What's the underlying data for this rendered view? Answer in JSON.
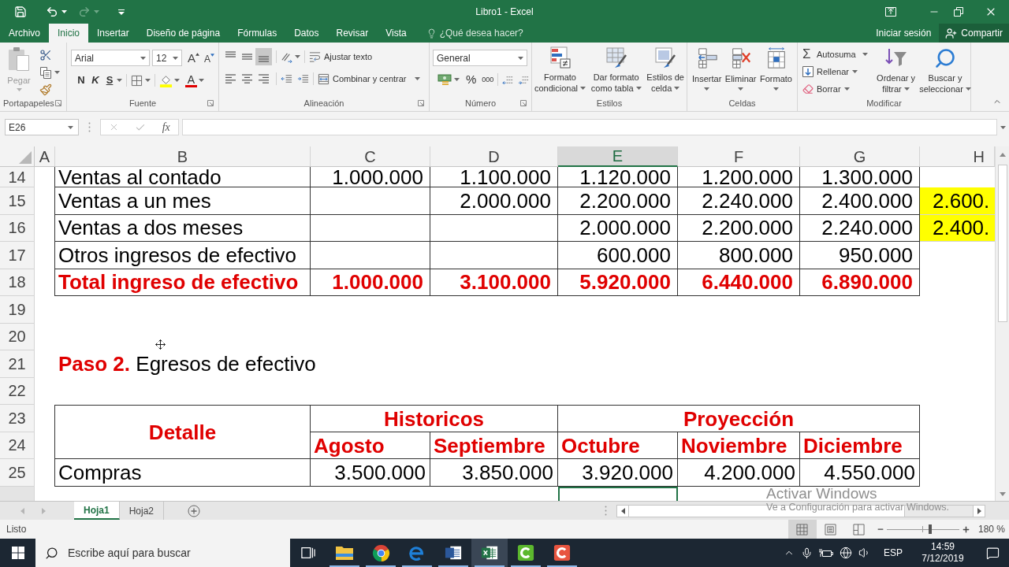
{
  "title_bar": {
    "title": "Libro1 - Excel",
    "redo": {
      "disabled": true
    }
  },
  "menu_tabs": [
    {
      "label": "Archivo",
      "selected": false
    },
    {
      "label": "Inicio",
      "selected": true
    },
    {
      "label": "Insertar",
      "selected": false
    },
    {
      "label": "Diseño de página",
      "selected": false
    },
    {
      "label": "Fórmulas",
      "selected": false
    },
    {
      "label": "Datos",
      "selected": false
    },
    {
      "label": "Revisar",
      "selected": false
    },
    {
      "label": "Vista",
      "selected": false
    }
  ],
  "tell_me": {
    "placeholder": "¿Qué desea hacer?"
  },
  "account": {
    "sign_in": "Iniciar sesión",
    "share": "Compartir"
  },
  "ribbon": {
    "clipboard": {
      "label": "Portapapeles",
      "paste": {
        "label": "Pegar",
        "disabled": true
      }
    },
    "font": {
      "label": "Fuente",
      "font_name": "Arial",
      "font_size": "12",
      "grow": "A",
      "shrink": "A",
      "bold": "N",
      "italic": "K",
      "underline": "S",
      "font_color": "A"
    },
    "alignment": {
      "label": "Alineación",
      "vertical": [
        {
          "kind": "top",
          "selected": false
        },
        {
          "kind": "middle",
          "selected": false
        },
        {
          "kind": "bottom",
          "selected": true
        }
      ],
      "horizontal": [
        {
          "kind": "left",
          "selected": false
        },
        {
          "kind": "center",
          "selected": false
        },
        {
          "kind": "right",
          "selected": false
        }
      ],
      "wrap_text": "Ajustar texto",
      "merge_center": "Combinar y centrar"
    },
    "number": {
      "label": "Número",
      "format": "General",
      "percent": "%",
      "thousands": "000"
    },
    "styles": {
      "label": "Estilos",
      "buttons": [
        {
          "kind": "conditional",
          "lines": [
            "Formato",
            "condicional"
          ]
        },
        {
          "kind": "table",
          "lines": [
            "Dar formato",
            "como tabla"
          ]
        },
        {
          "kind": "cell",
          "lines": [
            "Estilos de",
            "celda"
          ]
        }
      ]
    },
    "cells": {
      "label": "Celdas",
      "buttons": [
        {
          "kind": "insert",
          "label": "Insertar"
        },
        {
          "kind": "delete",
          "label": "Eliminar"
        },
        {
          "kind": "format",
          "label": "Formato"
        }
      ]
    },
    "editing": {
      "label": "Modificar",
      "autosum_symbol": "Σ",
      "autosum": "Autosuma",
      "fill": "Rellenar",
      "clear": "Borrar",
      "sort": [
        "Ordenar y",
        "filtrar"
      ],
      "find": [
        "Buscar y",
        "seleccionar"
      ]
    }
  },
  "formula_bar": {
    "name_box": "E26",
    "function_label": "fx"
  },
  "columns": [
    {
      "label": "A",
      "selected": false
    },
    {
      "label": "B",
      "selected": false
    },
    {
      "label": "C",
      "selected": false
    },
    {
      "label": "D",
      "selected": false
    },
    {
      "label": "E",
      "selected": true
    },
    {
      "label": "F",
      "selected": false
    },
    {
      "label": "G",
      "selected": false
    },
    {
      "label": "H",
      "selected": false
    }
  ],
  "inflows": {
    "rows": [
      {
        "number": "14",
        "label": "Ventas al contado",
        "values": {
          "c": "1.000.000",
          "d": "1.100.000",
          "e": "1.120.000",
          "f": "1.200.000",
          "g": "1.300.000"
        },
        "total": false
      },
      {
        "number": "15",
        "label": "Ventas a un mes",
        "values": {
          "d": "2.000.000",
          "e": "2.200.000",
          "f": "2.240.000",
          "g": "2.400.000"
        },
        "extra": {
          "text": "2.600.",
          "highlighted": true
        },
        "total": false
      },
      {
        "number": "16",
        "label": "Ventas a dos meses",
        "values": {
          "e": "2.000.000",
          "f": "2.200.000",
          "g": "2.240.000"
        },
        "extra": {
          "text": "2.400.",
          "highlighted": true
        },
        "total": false
      },
      {
        "number": "17",
        "label": "Otros ingresos de efectivo",
        "values": {
          "e": "600.000",
          "f": "800.000",
          "g": "950.000"
        },
        "total": false
      },
      {
        "number": "18",
        "label": "Total ingreso de efectivo",
        "values": {
          "c": "1.000.000",
          "d": "3.100.000",
          "e": "5.920.000",
          "f": "6.440.000",
          "g": "6.890.000"
        },
        "total": true
      }
    ]
  },
  "spacer_rows": [
    "19",
    "20"
  ],
  "step_2": {
    "number": "21",
    "title": "**Paso 2.** Egresos de efectivo"
  },
  "spacer_rows_2": [
    "22"
  ],
  "outflows": {
    "header_numbers": [
      "23",
      "24"
    ],
    "detail_header": "Detalle",
    "groups": [
      {
        "label": "Historicos",
        "months": [
          "Agosto",
          "Septiembre"
        ]
      },
      {
        "label": "Proyección",
        "months": [
          "Octubre",
          "Noviembre",
          "Diciembre"
        ]
      }
    ],
    "rows": [
      {
        "number": "25",
        "label": "Compras",
        "values": [
          "3.500.000",
          "3.850.000",
          "3.920.000",
          "4.200.000",
          "4.550.000"
        ]
      }
    ]
  },
  "sheet_tabs": [
    {
      "label": "Hoja1",
      "selected": true
    },
    {
      "label": "Hoja2",
      "selected": false
    }
  ],
  "status_bar": {
    "status": "Listo",
    "views": [
      {
        "kind": "normal",
        "selected": true
      },
      {
        "kind": "page_layout",
        "selected": false
      },
      {
        "kind": "page_break",
        "selected": false
      }
    ],
    "zoom": {
      "level": 0.6,
      "reading": "180 %"
    }
  },
  "activation_notice": {
    "title": "Activar Windows",
    "text": "Ve a Configuración para activar Windows."
  },
  "taskbar": {
    "search": {
      "placeholder": "Escribe aquí para buscar"
    },
    "apps": [
      {
        "kind": "task_view",
        "running": false,
        "active": false
      },
      {
        "kind": "explorer",
        "running": true,
        "active": false
      },
      {
        "kind": "chrome",
        "running": true,
        "active": false
      },
      {
        "kind": "edge",
        "running": true,
        "active": false
      },
      {
        "kind": "word",
        "running": true,
        "active": false
      },
      {
        "kind": "excel",
        "running": true,
        "active": true
      },
      {
        "kind": "camtasia_recorder",
        "running": true,
        "active": false
      },
      {
        "kind": "camtasia_editor",
        "running": true,
        "active": false
      }
    ],
    "language": "ESP",
    "time": "14:59",
    "date": "7/12/2019"
  }
}
